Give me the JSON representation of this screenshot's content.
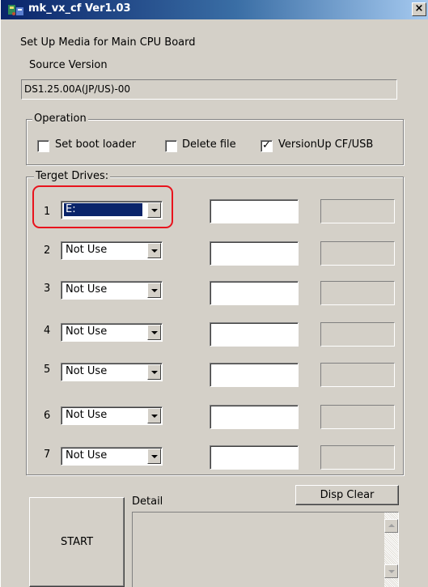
{
  "window": {
    "title": "mk_vx_cf  Ver1.03",
    "close_glyph": "×"
  },
  "header": {
    "subtitle": "Set Up Media for Main CPU Board",
    "source_version_label": "Source Version",
    "source_version_value": "DS1.25.00A(JP/US)-00"
  },
  "operation": {
    "title": "Operation",
    "options": [
      {
        "label": "Set boot loader",
        "checked": false
      },
      {
        "label": "Delete file",
        "checked": false
      },
      {
        "label": "VersionUp CF/USB",
        "checked": true
      }
    ],
    "check_glyph": "✓"
  },
  "target_drives": {
    "title": "Terget Drives:",
    "rows": [
      {
        "number": "1",
        "drive": "E:",
        "selected": true
      },
      {
        "number": "2",
        "drive": "Not Use",
        "selected": false
      },
      {
        "number": "3",
        "drive": "Not Use",
        "selected": false
      },
      {
        "number": "4",
        "drive": "Not Use",
        "selected": false
      },
      {
        "number": "5",
        "drive": "Not Use",
        "selected": false
      },
      {
        "number": "6",
        "drive": "Not Use",
        "selected": false
      },
      {
        "number": "7",
        "drive": "Not Use",
        "selected": false
      }
    ]
  },
  "controls": {
    "start_label": "START",
    "detail_label": "Detail",
    "disp_clear_label": "Disp Clear"
  },
  "colors": {
    "titlebar_start": "#0a246a",
    "titlebar_end": "#a6caf0",
    "highlight": "#e8131d",
    "window_bg": "#d4d0c8"
  }
}
